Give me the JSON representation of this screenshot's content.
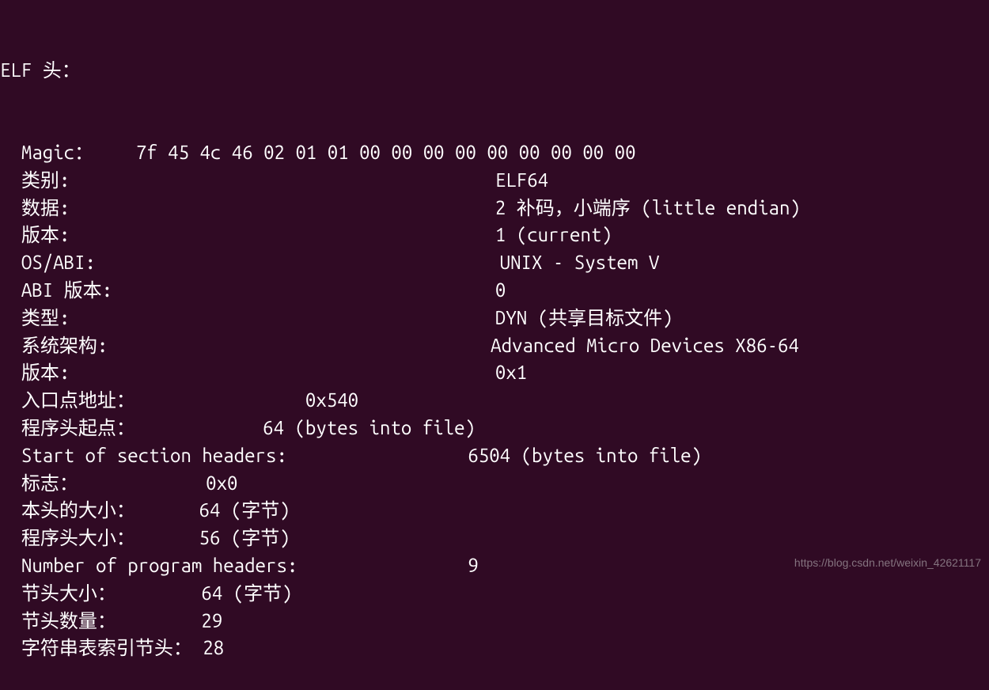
{
  "header": "ELF 头：",
  "rows": [
    {
      "label": "  Magic：   ",
      "value": "7f 45 4c 46 02 01 01 00 00 00 00 00 00 00 00 00 ",
      "col": 13
    },
    {
      "label": "  类别:",
      "value": "ELF64",
      "col": 47
    },
    {
      "label": "  数据:",
      "value": "2 补码，小端序 (little endian)",
      "col": 47
    },
    {
      "label": "  版本:",
      "value": "1 (current)",
      "col": 47
    },
    {
      "label": "  OS/ABI:",
      "value": "UNIX - System V",
      "col": 47
    },
    {
      "label": "  ABI 版本:",
      "value": "0",
      "col": 47
    },
    {
      "label": "  类型:",
      "value": "DYN (共享目标文件)",
      "col": 47
    },
    {
      "label": "  系统架构:",
      "value": "Advanced Micro Devices X86-64",
      "col": 47
    },
    {
      "label": "  版本:",
      "value": "0x1",
      "col": 47
    },
    {
      "label": "  入口点地址：",
      "value": "0x540",
      "col": 30
    },
    {
      "label": "  程序头起点：",
      "value": "64 (bytes into file)",
      "col": 26
    },
    {
      "label": "  Start of section headers:",
      "value": "6504 (bytes into file)",
      "col": 44
    },
    {
      "label": "  标志：",
      "value": "0x0",
      "col": 20
    },
    {
      "label": "  本头的大小：",
      "value": "64 (字节)",
      "col": 20
    },
    {
      "label": "  程序头大小：",
      "value": "56 (字节)",
      "col": 20
    },
    {
      "label": "  Number of program headers:",
      "value": "9",
      "col": 44
    },
    {
      "label": "  节头大小：",
      "value": "64 (字节)",
      "col": 20
    },
    {
      "label": "  节头数量：",
      "value": "29",
      "col": 20
    },
    {
      "label": "  字符串表索引节头：",
      "value": "28",
      "col": 20
    }
  ],
  "watermark": "https://blog.csdn.net/weixin_42621117"
}
